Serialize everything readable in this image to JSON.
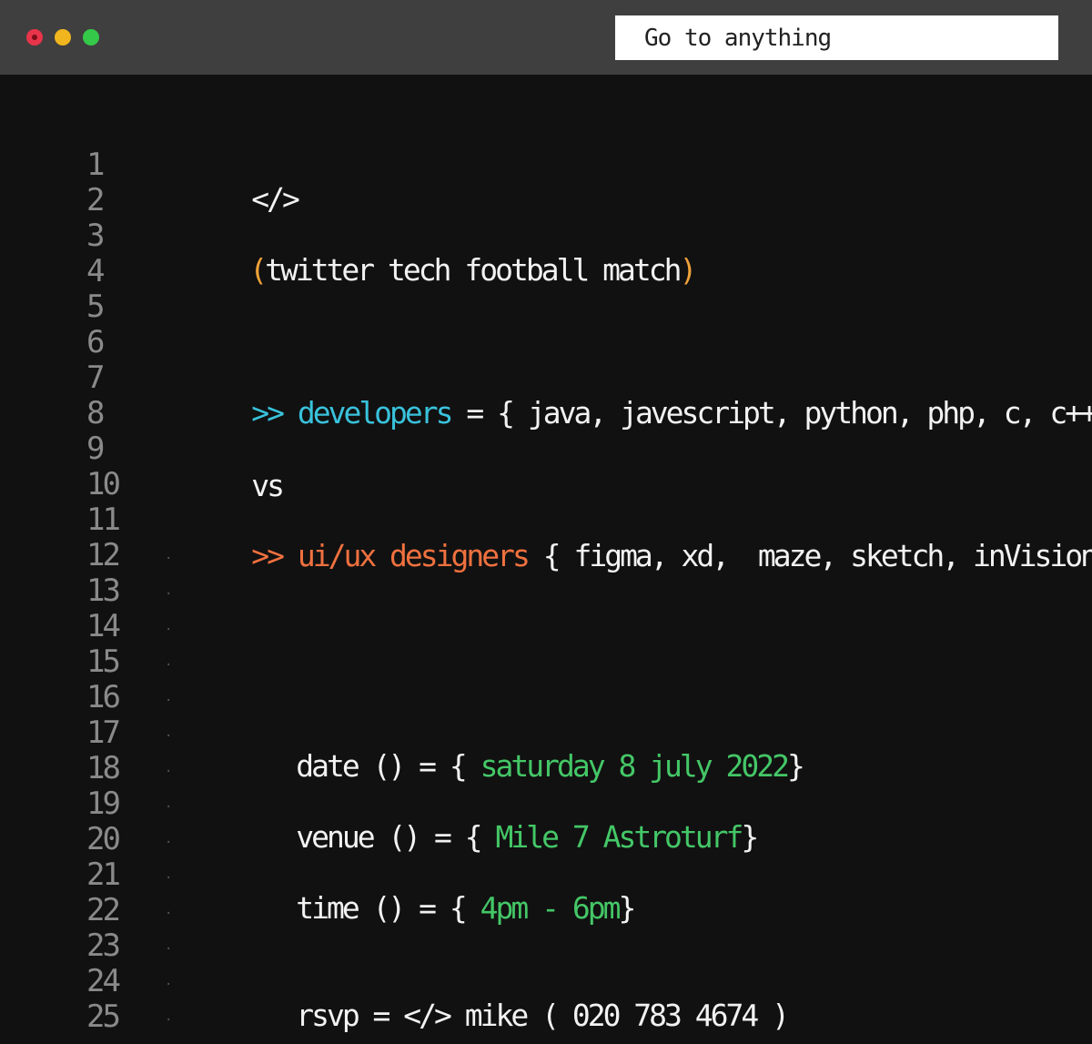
{
  "window": {
    "controls": [
      "close",
      "minimize",
      "maximize"
    ],
    "colors": {
      "close": "#e8344a",
      "minimize": "#f1b51e",
      "maximize": "#35c94a"
    }
  },
  "search": {
    "value": "Go to anything"
  },
  "editor": {
    "line_numbers": [
      "1",
      "2",
      "3",
      "4",
      "5",
      "6",
      "7",
      "8",
      "9",
      "10",
      "11",
      "12",
      "13",
      "14",
      "15",
      "16",
      "17",
      "18",
      "19",
      "20",
      "21",
      "22",
      "23",
      "24",
      "25"
    ],
    "line1": {
      "text": "</>"
    },
    "line3": {
      "open": "(",
      "text": "twitter tech football match",
      "close": ")"
    },
    "line7": {
      "prompt": ">>",
      "name": "developers",
      "rest": " = { java, javescript, python, php, c, c++ }"
    },
    "line9": {
      "text": "vs"
    },
    "line11": {
      "prompt": ">>",
      "name": "ui/ux designers",
      "rest": " { figma, xd,  maze, sketch, inVision }"
    },
    "line17": {
      "key": "date () = {",
      "value": "saturday 8 july 2022",
      "close": "}"
    },
    "line19": {
      "key": "venue () = {",
      "value": "Mile 7 Astroturf",
      "close": "}"
    },
    "line21": {
      "key": "time () = {",
      "value": "4pm - 6pm",
      "close": "}"
    },
    "line24": {
      "text": "rsvp = </> mike ( 020 783 4674 )"
    }
  },
  "colors": {
    "paren": "#f0a23a",
    "developers": "#39c2dc",
    "designers": "#f0713f",
    "values": "#44c767",
    "text": "#f2f2f2"
  }
}
